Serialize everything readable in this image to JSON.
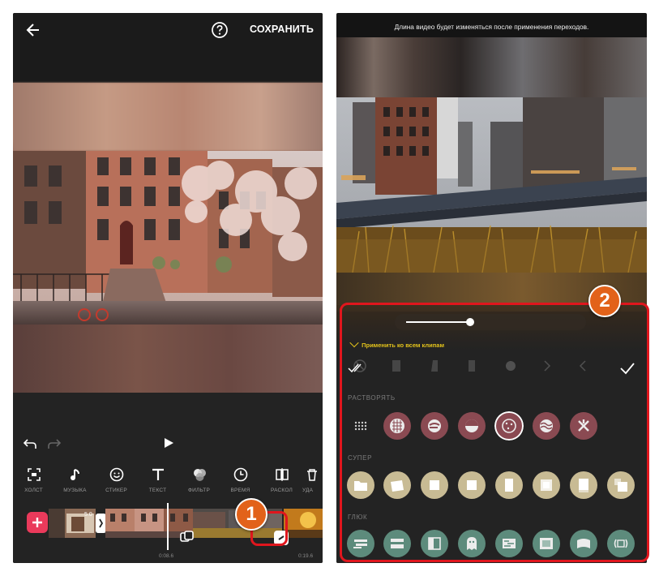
{
  "left_screen": {
    "header": {
      "save_label": "СОХРАНИТЬ"
    },
    "tools": [
      {
        "label": "ХОЛСТ",
        "icon": "canvas-icon"
      },
      {
        "label": "МУЗЫКА",
        "icon": "music-icon"
      },
      {
        "label": "СТИКЕР",
        "icon": "sticker-icon"
      },
      {
        "label": "ТЕКСТ",
        "icon": "text-icon"
      },
      {
        "label": "ФИЛЬТР",
        "icon": "filter-icon"
      },
      {
        "label": "ВРЕМЯ",
        "icon": "clock-icon"
      },
      {
        "label": "РАСКОЛ",
        "icon": "split-icon"
      },
      {
        "label": "УДА",
        "icon": "delete-icon"
      }
    ],
    "timeline": {
      "clip_label": "5.0",
      "time_marker_a": "0:08.6",
      "time_marker_b": "0:19.6"
    },
    "step_badge": "1"
  },
  "right_screen": {
    "notice": "Длина видео будет изменяться после применения переходов.",
    "apply_all_label": "Применить ко всем клипам",
    "duration_slider": 0.38,
    "sections": [
      {
        "title": "РАСТВОРЯТЬ"
      },
      {
        "title": "СУПЕР"
      },
      {
        "title": "ГЛЮК"
      }
    ],
    "step_badge": "2"
  },
  "colors": {
    "accent_red": "#e0161d",
    "badge_orange": "#e2621a",
    "add_button": "#ea3a5b",
    "apply_yellow": "#e3c21b",
    "dissolve_circle": "#8a4a52",
    "super_circle": "#c8bb94",
    "glitch_circle": "#5d8b7c"
  }
}
